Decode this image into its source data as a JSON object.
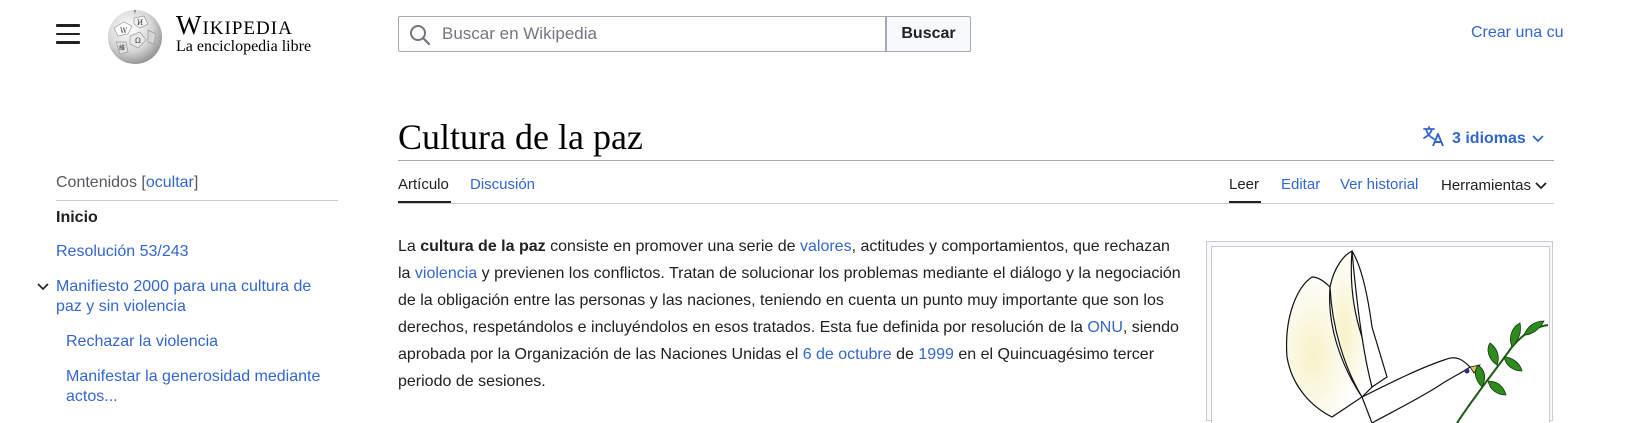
{
  "header": {
    "wordmark": "Wikipedia",
    "tagline": "La enciclopedia libre",
    "search_placeholder": "Buscar en Wikipedia",
    "search_button": "Buscar",
    "create_account": "Crear una cu"
  },
  "article": {
    "title": "Cultura de la paz",
    "languages": "3 idiomas",
    "tabs": {
      "article": "Artículo",
      "discussion": "Discusión"
    },
    "actions": {
      "read": "Leer",
      "edit": "Editar",
      "history": "Ver historial",
      "tools": "Herramientas"
    },
    "body": {
      "w1": "La ",
      "bold": "cultura de la paz",
      "w2": " consiste en promover una serie de ",
      "link_valores": "valores",
      "w3": ", actitudes y comportamientos, que rechazan la ",
      "link_violencia": "violencia",
      "w4": " y previenen los conflictos. Tratan de solucionar los problemas mediante el diálogo y la negociación de la obligación entre las personas y las naciones, teniendo en cuenta un punto muy importante que son los derechos, respetándolos e incluyéndolos en esos tratados. Esta fue definida por resolución de la ",
      "link_onu": "ONU",
      "w5": ", siendo aprobada por la Organización de las Naciones Unidas el ",
      "link_fecha": "6 de octubre",
      "w6": " de ",
      "link_anio": "1999",
      "w7": " en el Quincuagésimo tercer periodo de sesiones."
    }
  },
  "toc": {
    "heading": "Contenidos",
    "toggle": "ocultar",
    "items": [
      "Inicio",
      "Resolución 53/243",
      "Manifiesto 2000 para una cultura de paz y sin violencia",
      "Rechazar la violencia",
      "Manifestar la generosidad mediante actos..."
    ]
  },
  "icons": {
    "menu": "hamburger-icon",
    "logo": "wikipedia-globe-icon",
    "search": "search-icon",
    "language": "translate-icon",
    "chevron": "chevron-down-icon",
    "image": "peace-dove-image"
  },
  "colors": {
    "link": "#3366cc",
    "text": "#202122",
    "border": "#a2a9b1"
  }
}
